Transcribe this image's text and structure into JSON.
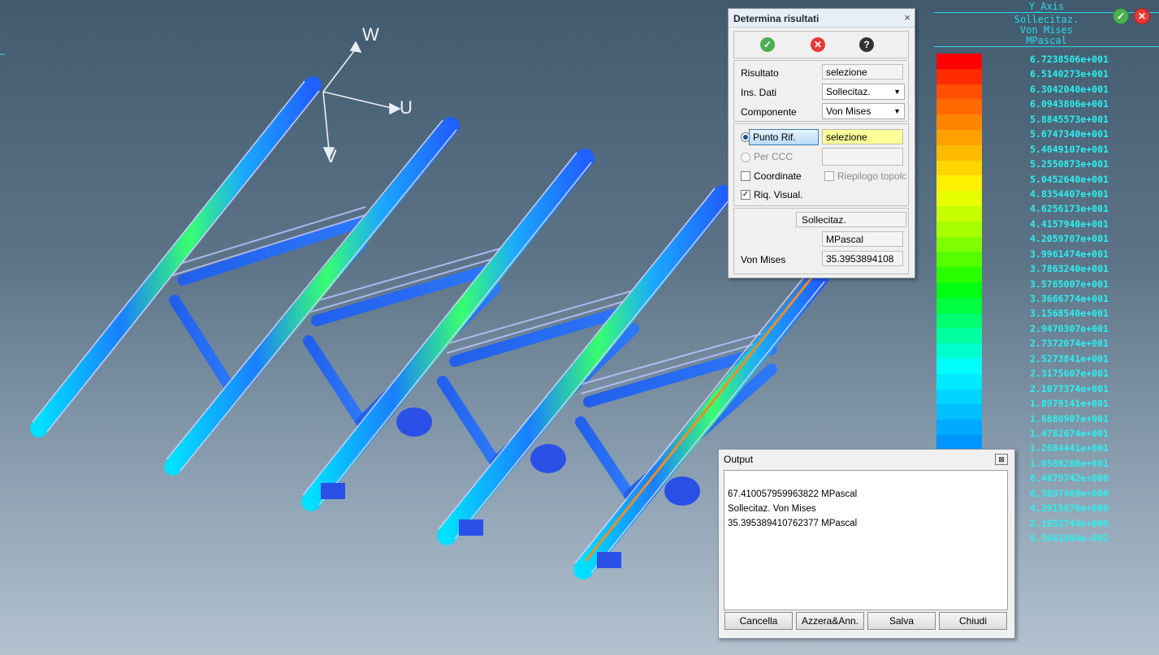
{
  "axes": {
    "w_label": "W",
    "u_label": "U",
    "v_label": "V"
  },
  "legend": {
    "header": [
      "Y_Axis",
      "Sollecitaz.",
      "Von Mises",
      "MPascal"
    ],
    "colors": [
      "#ff0000",
      "#ff2a00",
      "#ff4f00",
      "#ff6a00",
      "#ff8500",
      "#ffa000",
      "#ffbb00",
      "#ffd500",
      "#fff000",
      "#e8ff00",
      "#c8ff00",
      "#a8ff00",
      "#80ff00",
      "#55ff00",
      "#2aff00",
      "#00ff10",
      "#00ff40",
      "#00ff70",
      "#00ffa0",
      "#00ffcf",
      "#00ffff",
      "#00eaff",
      "#00d4ff",
      "#00bfff",
      "#00aaff",
      "#0095ff"
    ],
    "values": [
      "6.7238506e+001",
      "6.5140273e+001",
      "6.3042040e+001",
      "6.0943806e+001",
      "5.8845573e+001",
      "5.6747340e+001",
      "5.4649107e+001",
      "5.2550873e+001",
      "5.0452640e+001",
      "4.8354407e+001",
      "4.6256173e+001",
      "4.4157940e+001",
      "4.2059707e+001",
      "3.9961474e+001",
      "3.7863240e+001",
      "3.5765007e+001",
      "3.3666774e+001",
      "3.1568540e+001",
      "2.9470307e+001",
      "2.7372074e+001",
      "2.5273841e+001",
      "2.3175607e+001",
      "2.1077374e+001",
      "1.8979141e+001",
      "1.6880907e+001",
      "1.4782674e+001",
      "1.2684441e+001",
      "1.0586208e+001",
      "8.4879742e+000",
      "6.3897409e+000",
      "4.2915076e+000",
      "2.1932744e+000",
      "9.5041064e-002"
    ]
  },
  "dialog": {
    "title": "Determina risultati",
    "close": "×",
    "ok_icon": "✓",
    "cancel_icon": "✕",
    "help_icon": "?",
    "risultato_label": "Risultato",
    "risultato_value": "selezione",
    "ins_dati_label": "Ins. Dati",
    "ins_dati_value": "Sollecitaz.",
    "componente_label": "Componente",
    "componente_value": "Von Mises",
    "punto_rif_label": "Punto Rif.",
    "punto_rif_value": "selezione",
    "per_ccc_label": "Per CCC",
    "coordinate_label": "Coordinate",
    "riepilogo_label": "Riepilogo topolc",
    "riq_visual_label": "Riq. Visual.",
    "result_type": "Sollecitaz.",
    "result_unit": "MPascal",
    "result_label": "Von Mises",
    "result_value": "35.3953894108"
  },
  "output": {
    "title": "Output",
    "close": "⊠",
    "lines": [
      "67.410057959963822 MPascal",
      "Sollecitaz. Von Mises",
      "35.395389410762377 MPascal"
    ],
    "btn_cancella": "Cancella",
    "btn_azzera": "Azzera&Ann.",
    "btn_salva": "Salva",
    "btn_chiudi": "Chiudi"
  },
  "toolbar": {
    "ok_icon": "✓",
    "cancel_icon": "✕"
  }
}
